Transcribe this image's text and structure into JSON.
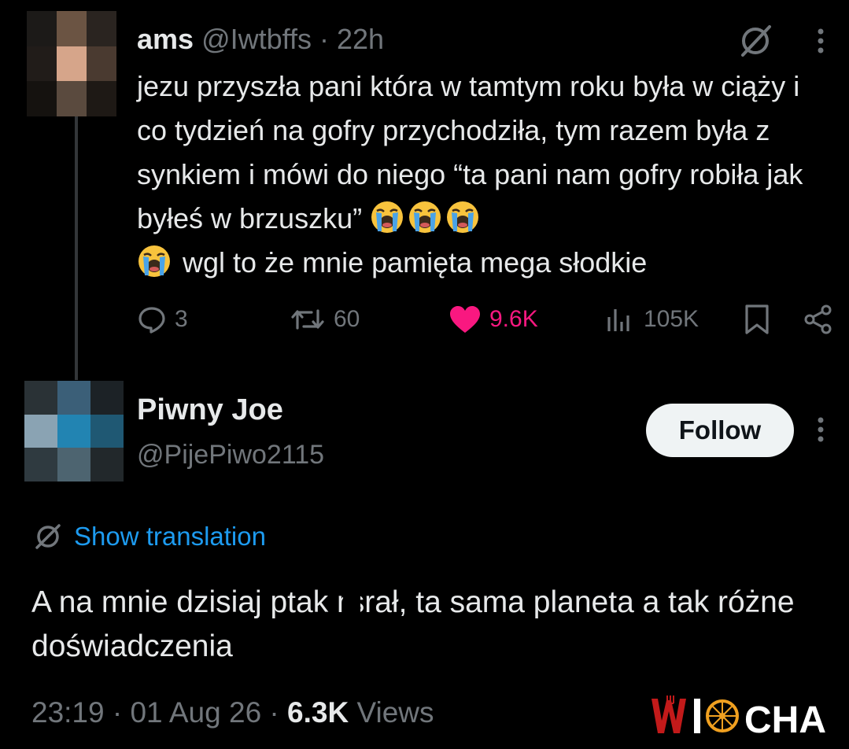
{
  "parent_tweet": {
    "display_name": "ams",
    "handle": "@Iwtbffs",
    "separator": " · ",
    "time_ago": "22h",
    "text_main": "jezu przyszła pani która w tamtym roku była w ciąży i co tydzień na gofry przychodziła, tym razem była z synkiem i mówi do niego “ta pani nam gofry robiła jak byłeś w brzuszku” ",
    "text_after": " wgl to że mnie pamięta mega słodkie",
    "emojis_inline": [
      "loudly-crying-face",
      "loudly-crying-face",
      "loudly-crying-face",
      "loudly-crying-face"
    ],
    "actions": {
      "replies": "3",
      "reposts": "60",
      "likes": "9.6K",
      "views": "105K"
    },
    "like_color": "#f91880"
  },
  "reply": {
    "display_name": "Piwny Joe",
    "handle": "@PijePiwo2115",
    "follow_label": "Follow",
    "translation_label": "Show translation",
    "text_before_censor": "A na mnie dzisiaj ptak n",
    "text_after_censor": "srał, ta sama planeta a tak różne doświadczenia",
    "time": "23:19",
    "date": "01 Aug 26",
    "dot": " · ",
    "views_count": "6.3K",
    "views_label": " Views"
  },
  "watermark": {
    "text": "WIOCHA",
    "accent": "#c21a1a"
  },
  "colors": {
    "background": "#000000",
    "text": "#e7e9ea",
    "muted": "#71767b",
    "link": "#1d9bf0"
  },
  "icons": [
    "grok-icon",
    "more-icon",
    "reply-icon",
    "repost-icon",
    "heart-icon",
    "views-icon",
    "bookmark-icon",
    "share-icon",
    "translate-icon"
  ]
}
